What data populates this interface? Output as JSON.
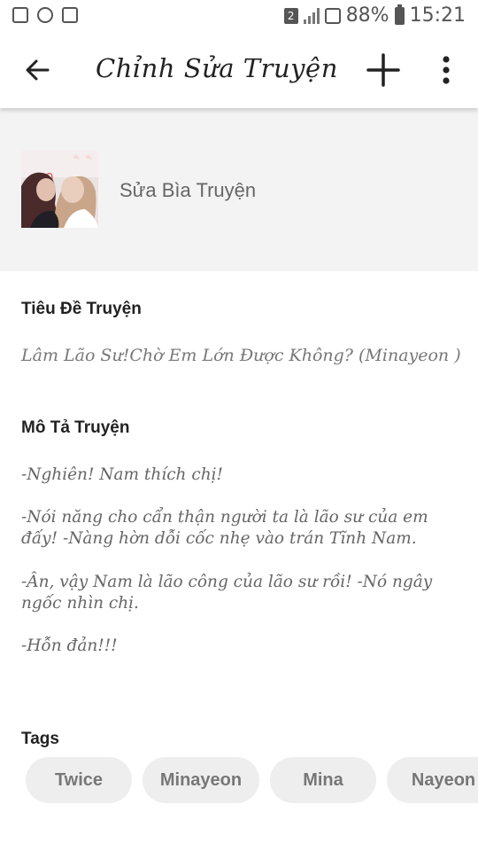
{
  "status": {
    "sim_badge": "2",
    "battery": "88%",
    "time": "15:21",
    "icons": [
      "gallery-icon",
      "sync-icon",
      "notification-icon"
    ]
  },
  "app_bar": {
    "title": "Chỉnh Sửa Truyện",
    "back_icon": "arrow-left-icon",
    "add_icon": "plus-icon",
    "more_icon": "more-vertical-icon"
  },
  "cover": {
    "label": "Sửa Bìa Truyện"
  },
  "title_section": {
    "label": "Tiêu Đề Truyện",
    "value": "Lâm Lão Sư!Chờ Em Lớn Được Không? (Minayeon )"
  },
  "description_section": {
    "label": "Mô Tả Truyện",
    "lines": [
      "-Nghiên! Nam thích chị!",
      "-Nói năng cho cẩn thận người ta là lão sư của em",
      "đấy! -Nàng hờn dỗi cốc nhẹ vào trán Tĩnh Nam.",
      "-Ân, vậy Nam là lão công của lão sư rồi! -Nó ngây",
      "ngốc nhìn chị.",
      "-Hỗn đản!!!"
    ]
  },
  "tags_section": {
    "label": "Tags",
    "tags": [
      "Twice",
      "Minayeon",
      "Mina",
      "Nayeon"
    ]
  },
  "colors": {
    "accent": "#222222",
    "cover_bg": "#f3f3f3",
    "tag_bg": "#eeeeee"
  }
}
